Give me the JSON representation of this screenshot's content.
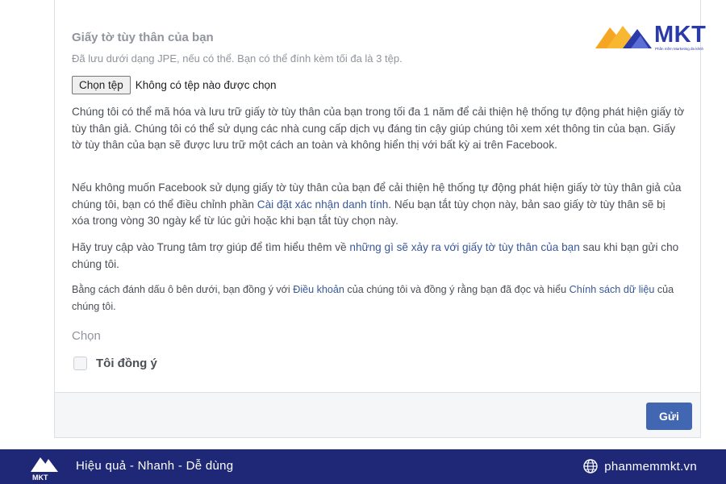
{
  "form": {
    "section_title": "Giấy tờ tùy thân của bạn",
    "section_sub": "Đã lưu dưới dạng JPE, nếu có thể. Bạn có thể đính kèm tối đa là 3 tệp.",
    "file_button": "Chọn tệp",
    "file_status": "Không có tệp nào được chọn",
    "para1": "Chúng tôi có thể mã hóa và lưu trữ giấy tờ tùy thân của bạn trong tối đa 1 năm để cải thiện hệ thống tự động phát hiện giấy tờ tùy thân giả. Chúng tôi có thể sử dụng các nhà cung cấp dịch vụ đáng tin cậy giúp chúng tôi xem xét thông tin của bạn. Giấy tờ tùy thân của bạn sẽ được lưu trữ một cách an toàn và không hiển thị với bất kỳ ai trên Facebook.",
    "para2_a": "Nếu không muốn Facebook sử dụng giấy tờ tùy thân của bạn để cải thiện hệ thống tự động phát hiện giấy tờ tùy thân giả của chúng tôi, bạn có thể điều chỉnh phần ",
    "para2_link": "Cài đặt xác nhận danh tính",
    "para2_b": ". Nếu bạn tắt tùy chọn này, bản sao giấy tờ tùy thân sẽ bị xóa trong vòng 30 ngày kể từ lúc gửi hoặc khi bạn tắt tùy chọn này.",
    "para3_a": "Hãy truy cập vào Trung tâm trợ giúp để tìm hiểu thêm về ",
    "para3_link": "những gì sẽ xảy ra với giấy tờ tùy thân của bạn",
    "para3_b": " sau khi bạn gửi cho chúng tôi.",
    "para4_a": "Bằng cách đánh dấu ô bên dưới, bạn đồng ý với ",
    "para4_link1": "Điều khoản",
    "para4_b": " của chúng tôi và đồng ý rằng bạn đã đọc và hiểu ",
    "para4_link2": "Chính sách dữ liệu",
    "para4_c": " của chúng tôi.",
    "choose_label": "Chọn",
    "agree_label": "Tôi đồng ý",
    "agree_checked": false,
    "submit_label": "Gửi"
  },
  "branding": {
    "logo_text": "MKT",
    "logo_tagline": "Phần mềm Marketing đa kênh",
    "slogan": "Hiệu quả - Nhanh - Dễ dùng",
    "website": "phanmemmkt.vn",
    "icons": [
      "mkt-logo-icon",
      "globe-icon"
    ]
  },
  "colors": {
    "accent": "#4267b2",
    "link": "#385898",
    "banner": "#1e2876",
    "logo_blue": "#2a3aa8",
    "logo_orange": "#f5a623"
  }
}
